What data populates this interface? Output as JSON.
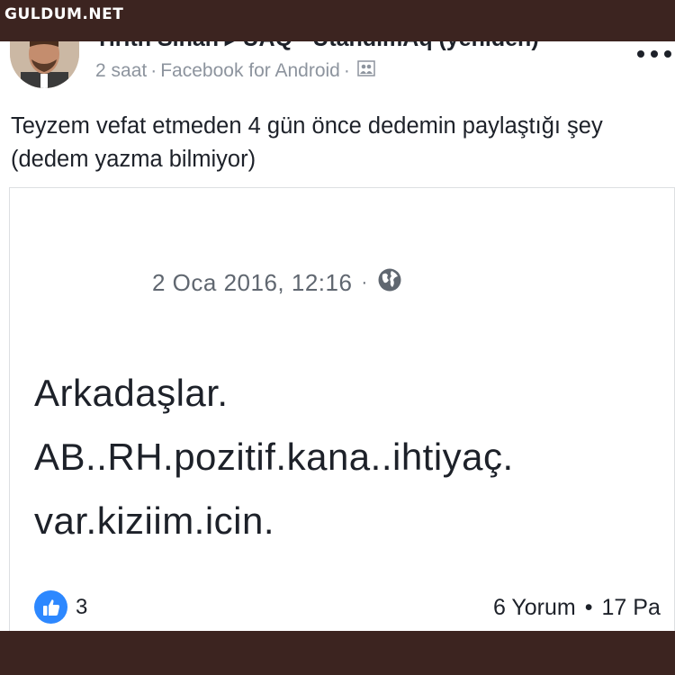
{
  "watermark": "GULDUM.NET",
  "post": {
    "author_line": "Tirith Sinan ▸ UAQ - UtandimAq (yeniden)",
    "time": "2 saat",
    "source": "Facebook for Android",
    "privacy_icon": "group-icon",
    "more_icon": "more-dots-icon",
    "text_lines": [
      "Teyzem vefat etmeden 4 gün önce dedemin paylaştığı şey",
      "(dedem yazma bilmiyor)"
    ]
  },
  "shared": {
    "date": "2 Oca 2016, 12:16",
    "separator": "·",
    "privacy_icon": "globe-icon",
    "body_lines": [
      "Arkadaşlar.",
      "AB..RH.pozitif.kana..ihtiyaç.",
      "var.kiziim.icin."
    ],
    "reactions": {
      "icon": "like-icon",
      "count": "3",
      "comments": "6 Yorum",
      "separator": "•",
      "shares": "17 Pa"
    }
  },
  "colors": {
    "frame": "#3c2420",
    "like_blue": "#2d88ff",
    "meta_gray": "#8d949e",
    "text_dark": "#1d2129"
  }
}
